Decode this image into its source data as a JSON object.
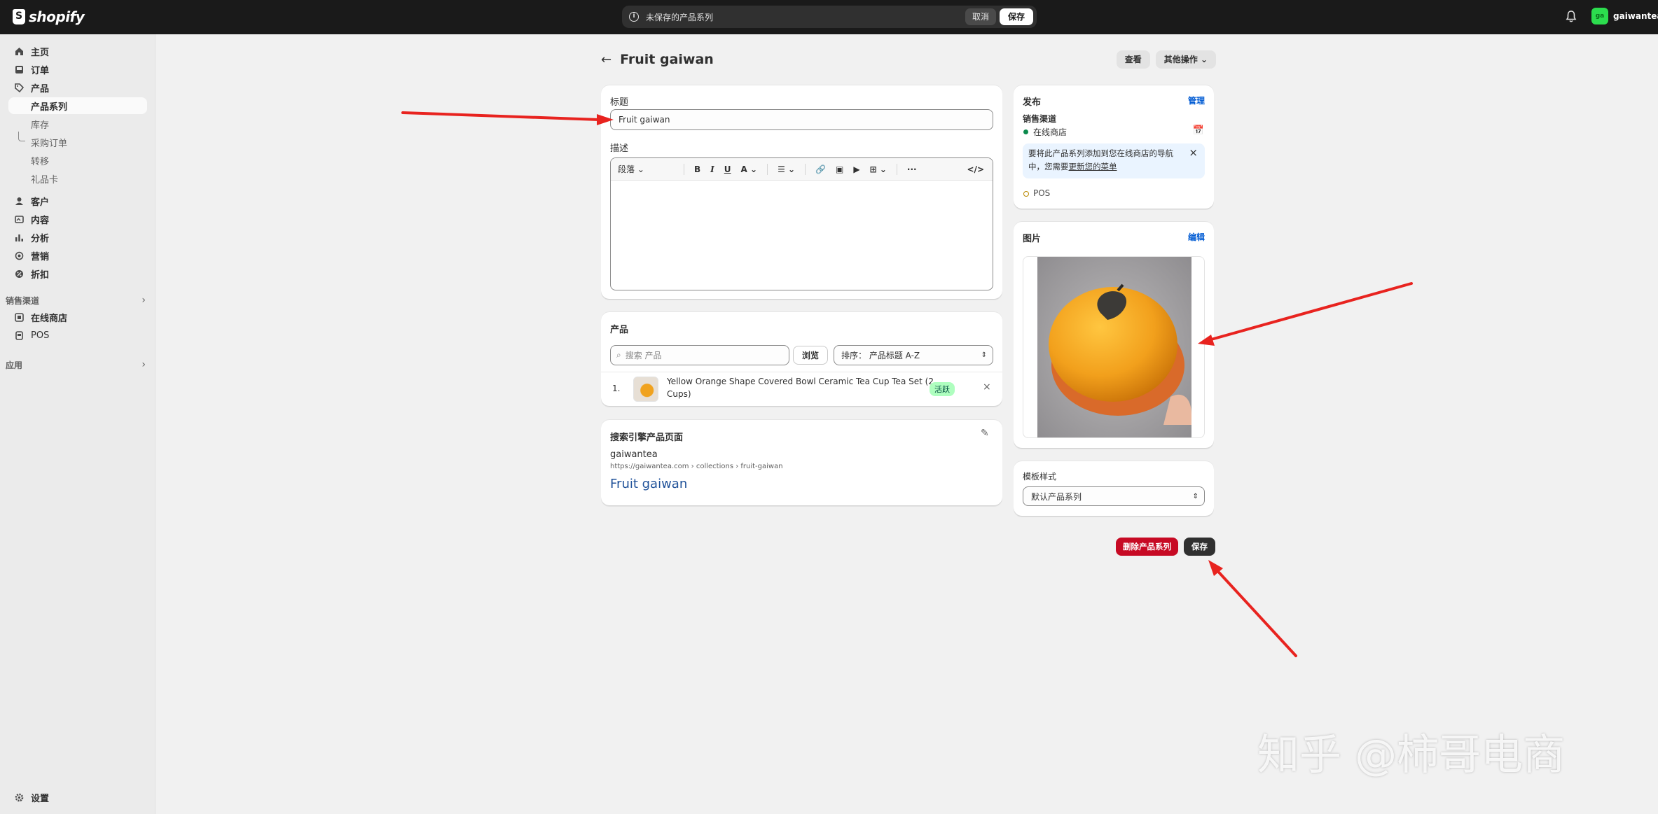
{
  "topbar": {
    "logo_text": "shopify",
    "unsaved_text": "未保存的产品系列",
    "discard_label": "取消",
    "save_label": "保存",
    "store_name": "gaiwantea",
    "store_initials": "ga"
  },
  "sidebar": {
    "items": [
      {
        "label": "主页",
        "icon": "home-icon"
      },
      {
        "label": "订单",
        "icon": "inbox-icon"
      },
      {
        "label": "产品",
        "icon": "tag-icon"
      }
    ],
    "product_sub": [
      "产品系列",
      "库存",
      "采购订单",
      "转移",
      "礼品卡"
    ],
    "items2": [
      {
        "label": "客户",
        "icon": "person-icon"
      },
      {
        "label": "内容",
        "icon": "content-icon"
      },
      {
        "label": "分析",
        "icon": "chart-icon"
      },
      {
        "label": "营销",
        "icon": "target-icon"
      },
      {
        "label": "折扣",
        "icon": "discount-icon"
      }
    ],
    "sales_channels_title": "销售渠道",
    "channels": [
      "在线商店",
      "POS"
    ],
    "apps_title": "应用",
    "settings_label": "设置"
  },
  "page": {
    "title": "Fruit gaiwan",
    "view_label": "查看",
    "more_actions_label": "其他操作"
  },
  "form": {
    "title_label": "标题",
    "title_value": "Fruit gaiwan",
    "description_label": "描述",
    "paragraph_label": "段落"
  },
  "products": {
    "heading": "产品",
    "search_placeholder": "搜索 产品",
    "browse_label": "浏览",
    "sort_label": "排序： 产品标题 A-Z",
    "rows": [
      {
        "index": "1.",
        "name": "Yellow Orange Shape Covered Bowl Ceramic Tea Cup Tea Set (2",
        "name2": "Cups)",
        "status": "活跃"
      }
    ]
  },
  "seo": {
    "heading": "搜索引擎产品页面",
    "site": "gaiwantea",
    "url": "https://gaiwantea.com › collections › fruit-gaiwan",
    "title": "Fruit gaiwan"
  },
  "publishing": {
    "heading": "发布",
    "manage_label": "管理",
    "channels_label": "销售渠道",
    "online_store": "在线商店",
    "banner_text_1": "要将此产品系列添加到您在线商店的导航",
    "banner_text_2": "中，您需要",
    "banner_link": "更新您的菜单",
    "pos": "POS"
  },
  "image_card": {
    "heading": "图片",
    "edit_label": "编辑"
  },
  "template": {
    "label": "模板样式",
    "value": "默认产品系列"
  },
  "footer": {
    "delete_label": "删除产品系列",
    "save_label": "保存"
  },
  "watermark": "知乎 @柿哥电商",
  "colors": {
    "topbar": "#1a1a1a",
    "accent_blue": "#005bd3",
    "danger": "#c70a24",
    "arrow": "#e8231f",
    "active_badge": "#affebf"
  }
}
